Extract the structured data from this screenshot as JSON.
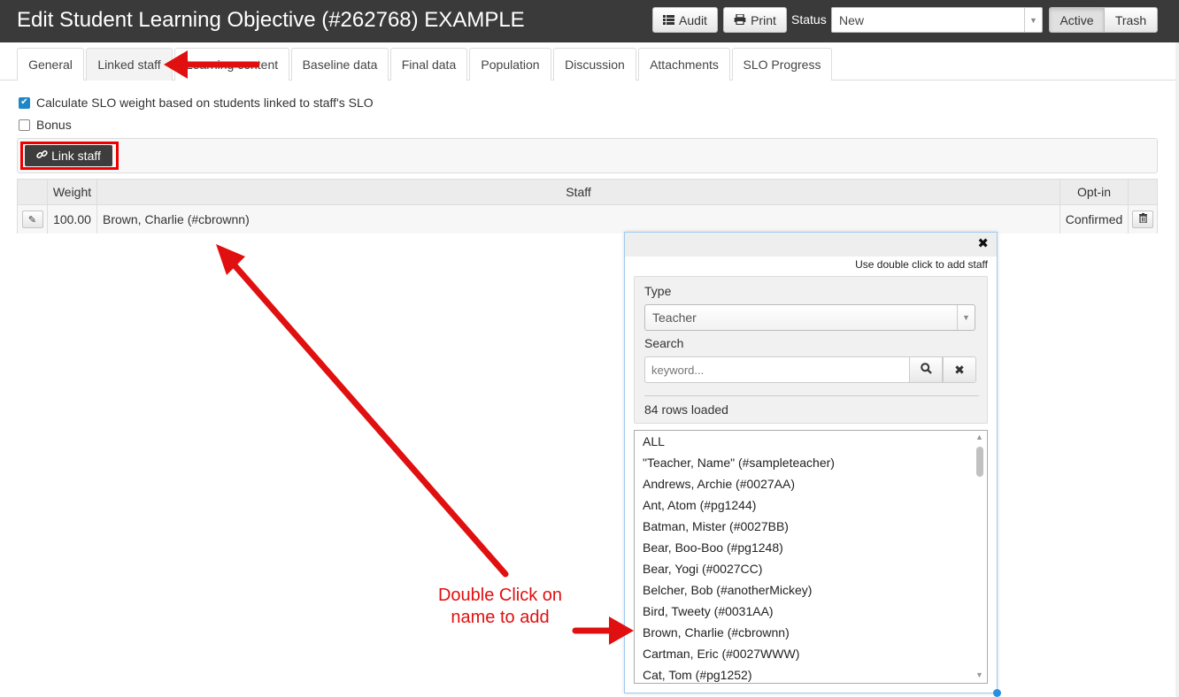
{
  "header": {
    "title": "Edit Student Learning Objective (#262768) EXAMPLE",
    "audit_label": "Audit",
    "print_label": "Print",
    "status_label": "Status",
    "status_value": "New",
    "active_label": "Active",
    "trash_label": "Trash"
  },
  "tabs": [
    {
      "label": "General"
    },
    {
      "label": "Linked staff"
    },
    {
      "label": "Learning content"
    },
    {
      "label": "Baseline data"
    },
    {
      "label": "Final data"
    },
    {
      "label": "Population"
    },
    {
      "label": "Discussion"
    },
    {
      "label": "Attachments"
    },
    {
      "label": "SLO Progress"
    }
  ],
  "options": {
    "calc_weight_label": "Calculate SLO weight based on students linked to staff's SLO",
    "calc_weight_checked": true,
    "bonus_label": "Bonus",
    "bonus_checked": false
  },
  "toolbar": {
    "link_staff_label": "Link staff"
  },
  "table": {
    "headers": {
      "weight": "Weight",
      "staff": "Staff",
      "optin": "Opt-in"
    },
    "rows": [
      {
        "weight": "100.00",
        "staff": "Brown, Charlie (#cbrownn)",
        "optin": "Confirmed"
      }
    ]
  },
  "popup": {
    "hint": "Use double click to add staff",
    "type_label": "Type",
    "type_value": "Teacher",
    "search_label": "Search",
    "search_placeholder": "keyword...",
    "rows_loaded": "84 rows loaded",
    "items": [
      "ALL",
      "\"Teacher, Name\" (#sampleteacher)",
      "Andrews, Archie (#0027AA)",
      "Ant, Atom (#pg1244)",
      "Batman, Mister (#0027BB)",
      "Bear, Boo-Boo (#pg1248)",
      "Bear, Yogi (#0027CC)",
      "Belcher, Bob (#anotherMickey)",
      "Bird, Tweety (#0031AA)",
      "Brown, Charlie (#cbrownn)",
      "Cartman, Eric (#0027WWW)",
      "Cat, Tom (#pg1252)"
    ]
  },
  "annotation": {
    "line1": "Double Click on",
    "line2": "name to add",
    "color": "#e01010"
  },
  "colors": {
    "header_bg": "#3a3a3a",
    "checkbox_blue": "#1e88c7",
    "popup_border": "#9ecaf0"
  }
}
